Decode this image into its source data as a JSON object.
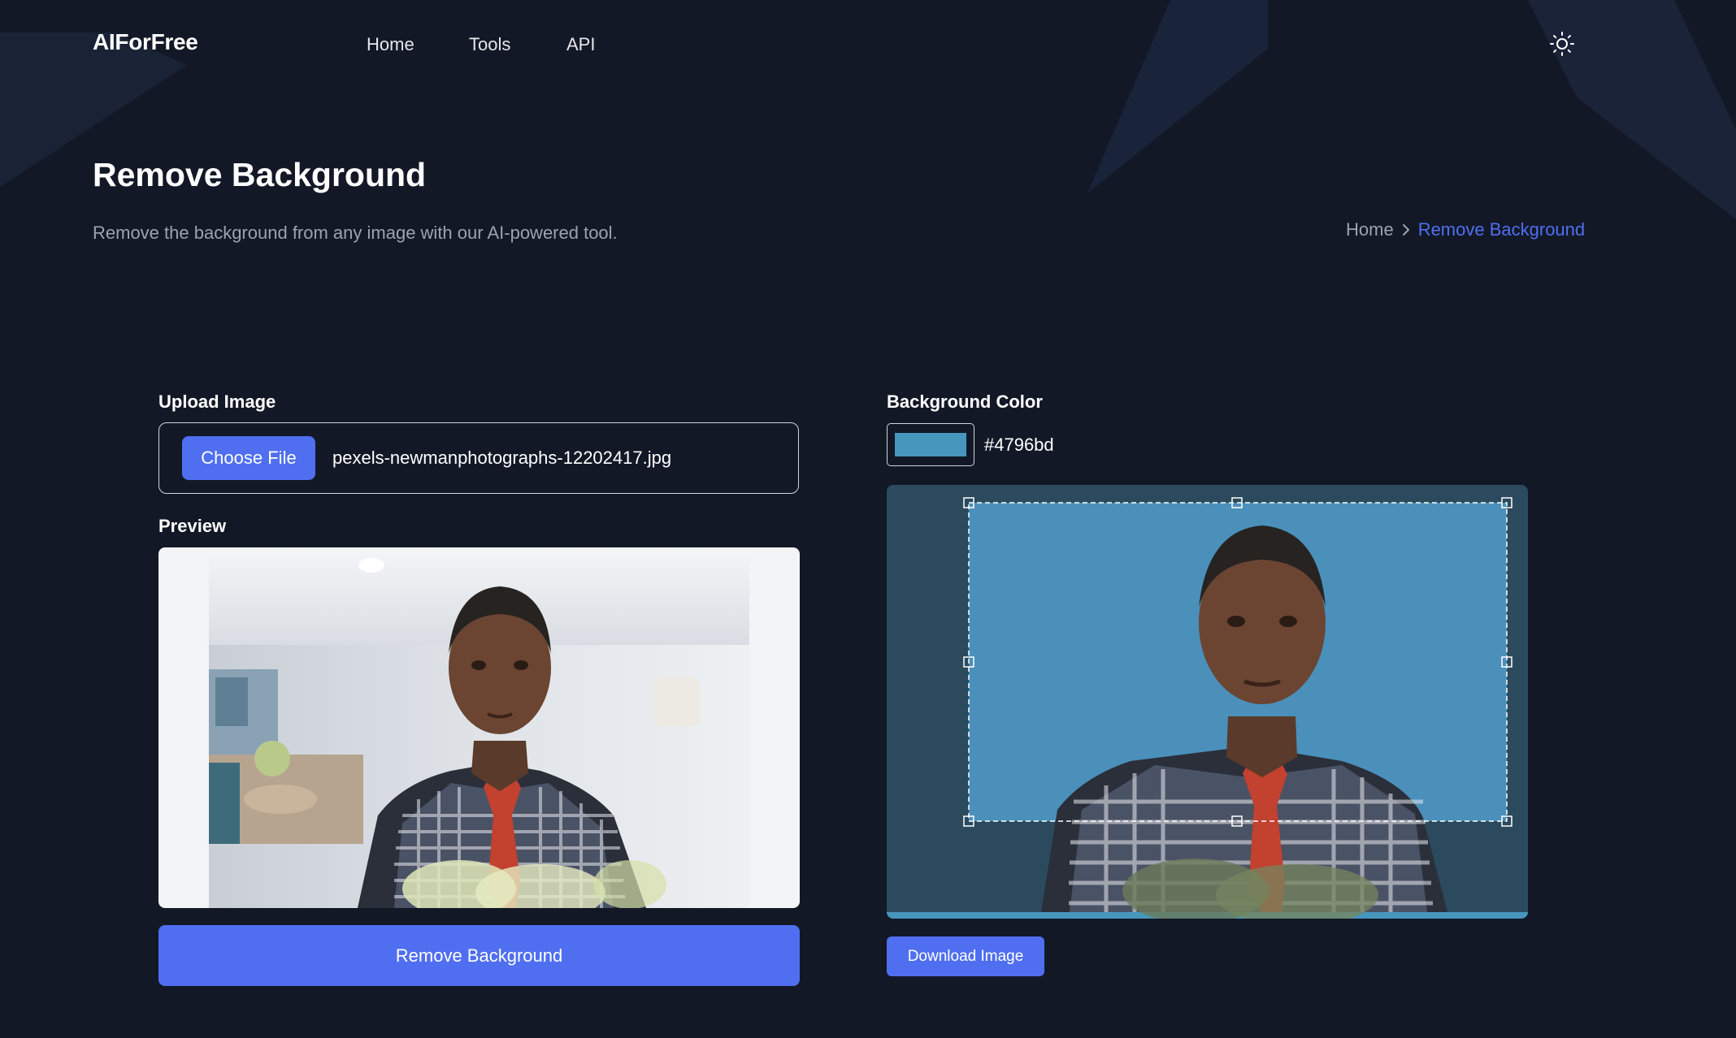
{
  "brand": {
    "name": "AIForFree"
  },
  "nav": {
    "items": [
      {
        "label": "Home"
      },
      {
        "label": "Tools"
      },
      {
        "label": "API"
      }
    ]
  },
  "theme_toggle": {
    "icon": "sun-icon"
  },
  "hero": {
    "title": "Remove Background",
    "subtitle": "Remove the background from any image with our AI-powered tool."
  },
  "breadcrumb": {
    "home": "Home",
    "current": "Remove Background"
  },
  "upload": {
    "label": "Upload Image",
    "button_label": "Choose File",
    "file_name": "pexels-newmanphotographs-12202417.jpg"
  },
  "preview": {
    "label": "Preview"
  },
  "actions": {
    "remove_label": "Remove Background",
    "download_label": "Download Image"
  },
  "background_color": {
    "label": "Background Color",
    "value": "#4796bd"
  },
  "colors": {
    "page_bg": "#121826",
    "accent": "#4f6ff0",
    "result_bg": "#2b4a5d",
    "muted_text": "#9ca3af"
  }
}
